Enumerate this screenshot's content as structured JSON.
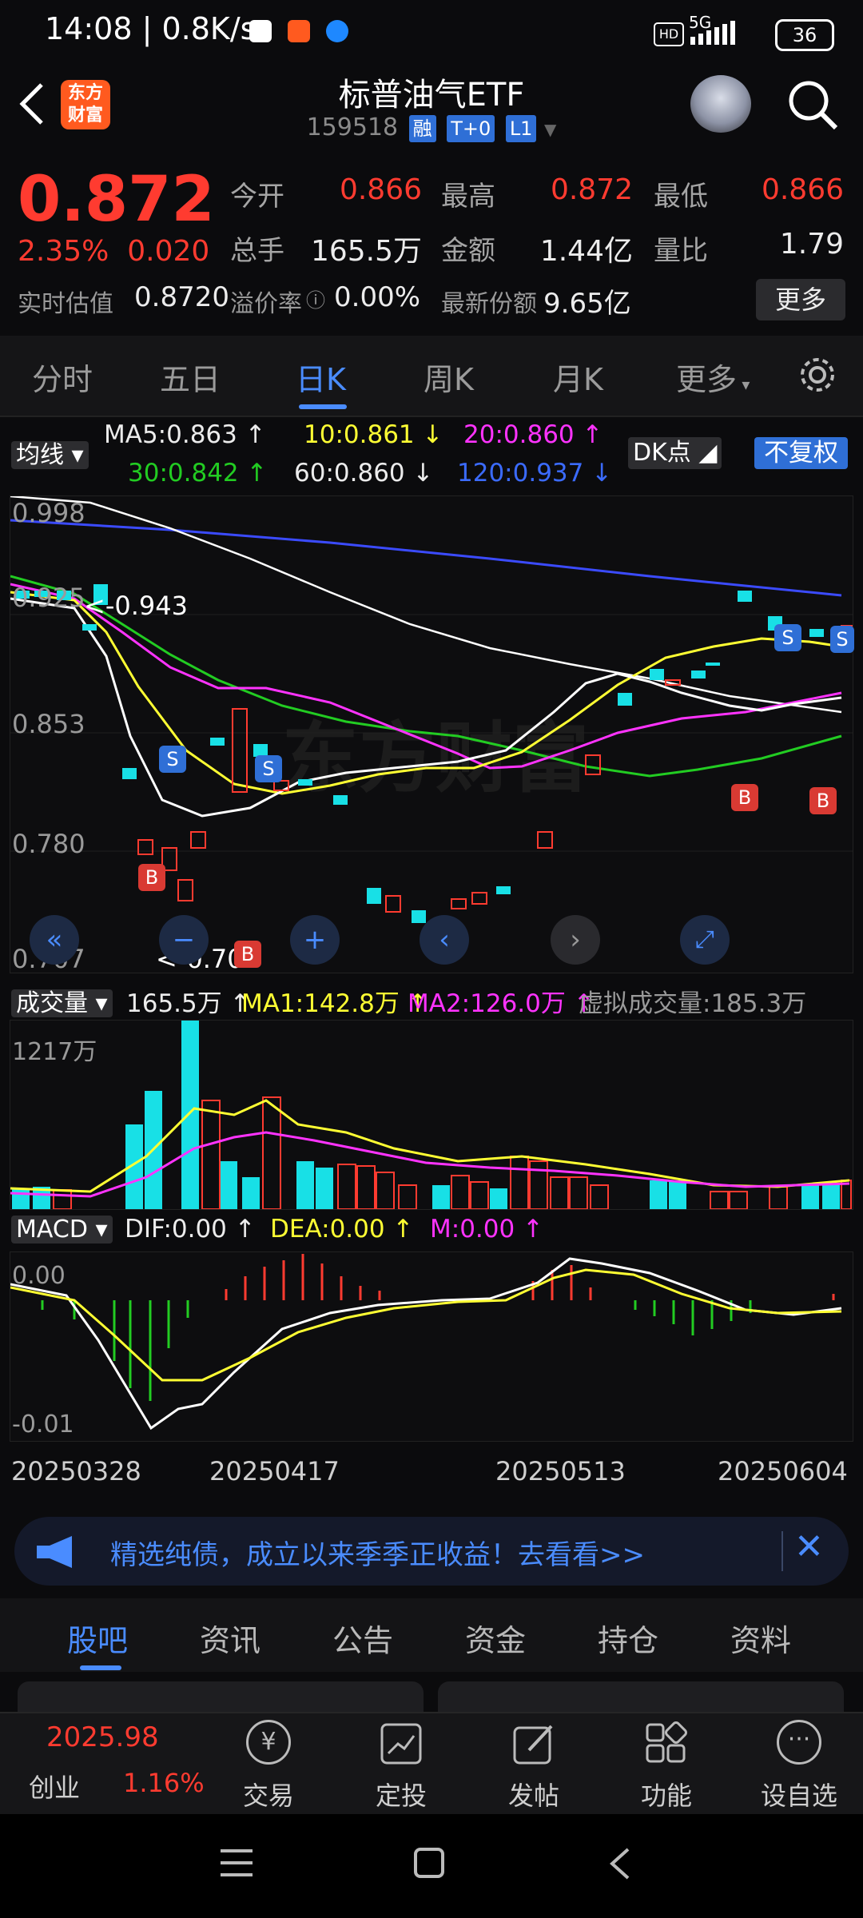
{
  "status_bar": {
    "time": "14:08 | 0.8K/s",
    "network": "5G",
    "battery": "36"
  },
  "header": {
    "title": "标普油气ETF",
    "code": "159518",
    "tags": [
      "融",
      "T+0",
      "L1"
    ]
  },
  "quote": {
    "price": "0.872",
    "change_pct": "2.35%",
    "change": "0.020",
    "open_label": "今开",
    "open": "0.866",
    "high_label": "最高",
    "high": "0.872",
    "low_label": "最低",
    "low": "0.866",
    "volume_label": "总手",
    "volume": "165.5万",
    "amount_label": "金额",
    "amount": "1.44亿",
    "ratio_label": "量比",
    "ratio": "1.79",
    "estimate_label": "实时估值",
    "estimate": "0.8720",
    "premium_label": "溢价率",
    "premium": "0.00%",
    "shares_label": "最新份额",
    "shares": "9.65亿",
    "more_label": "更多"
  },
  "tabs": {
    "items": [
      "分时",
      "五日",
      "日K",
      "周K",
      "月K",
      "更多"
    ],
    "active": "日K"
  },
  "ma_row": {
    "selector": "均线",
    "ma5": "MA5:0.863 ↑",
    "ma10": "10:0.861 ↓",
    "ma20": "20:0.860 ↑",
    "ma30": "30:0.842 ↑",
    "ma60": "60:0.860 ↓",
    "ma120": "120:0.937 ↓",
    "dk_label": "DK点",
    "fq_label": "不复权"
  },
  "kline": {
    "y_labels": [
      "0.998",
      "0.925",
      "0.853",
      "0.780",
      "0.707"
    ],
    "max_label": "0.943",
    "min_label": "<-0.707",
    "watermark": "东方财富"
  },
  "volume_row": {
    "selector": "成交量",
    "vol": "165.5万 ↑",
    "ma1": "MA1:142.8万 ↑",
    "ma2": "MA2:126.0万 ↑",
    "virtual": "虚拟成交量:185.3万",
    "max_label": "1217万"
  },
  "macd_row": {
    "selector": "MACD",
    "dif": "DIF:0.00 ↑",
    "dea": "DEA:0.00 ↑",
    "m": "M:0.00 ↑",
    "top_label": "0.00",
    "bottom_label": "-0.01"
  },
  "x_axis": [
    "20250328",
    "20250417",
    "20250513",
    "20250604"
  ],
  "banner": {
    "text": "精选纯债，成立以来季季正收益！去看看>>"
  },
  "subtabs": {
    "items": [
      "股吧",
      "资讯",
      "公告",
      "资金",
      "持仓",
      "资料"
    ],
    "active": "股吧"
  },
  "bottom_nav": {
    "index_value": "2025.98",
    "index_name": "创业",
    "index_change": "1.16%",
    "items": [
      "交易",
      "定投",
      "发帖",
      "功能",
      "设自选"
    ]
  },
  "colors": {
    "up": "#ff3b30",
    "down": "#18e0e6",
    "accent": "#4a8cff",
    "ma5": "#ffffff",
    "ma10": "#ffff33",
    "ma20": "#ff33ff",
    "ma30": "#22cc22",
    "ma60": "#ffffff",
    "ma120": "#3b4bff"
  }
}
